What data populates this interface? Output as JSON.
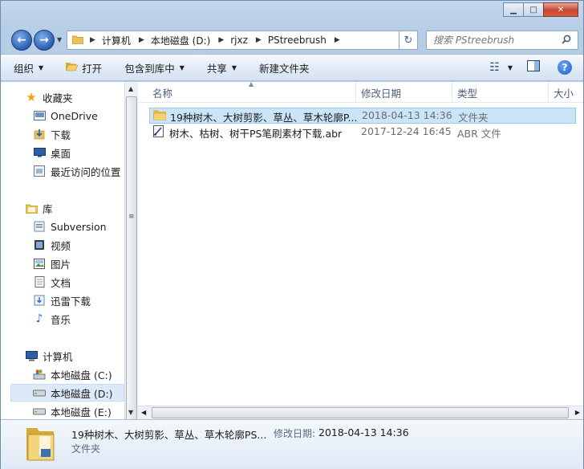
{
  "window": {
    "minimize_icon": "minimize-icon",
    "maximize_icon": "maximize-icon",
    "close_icon": "close-icon"
  },
  "address": {
    "segments": [
      "计算机",
      "本地磁盘 (D:)",
      "rjxz",
      "PStreebrush"
    ],
    "search_placeholder": "搜索 PStreebrush"
  },
  "toolbar": {
    "organize": "组织",
    "open": "打开",
    "include_library": "包含到库中",
    "share": "共享",
    "new_folder": "新建文件夹"
  },
  "nav": {
    "favorites_header": "收藏夹",
    "favorites": [
      "OneDrive",
      "下载",
      "桌面",
      "最近访问的位置"
    ],
    "libraries_header": "库",
    "libraries": [
      "Subversion",
      "视频",
      "图片",
      "文档",
      "迅雷下载",
      "音乐"
    ],
    "computer_header": "计算机",
    "drives": [
      "本地磁盘 (C:)",
      "本地磁盘 (D:)",
      "本地磁盘 (E:)"
    ],
    "selected": "本地磁盘 (D:)"
  },
  "columns": {
    "name": "名称",
    "date": "修改日期",
    "type": "类型",
    "size": "大小"
  },
  "files": [
    {
      "name": "19种树木、大树剪影、草丛、草木轮廓P...",
      "date": "2018-04-13 14:36",
      "type": "文件夹",
      "icon": "folder-icon",
      "selected": true
    },
    {
      "name": "树木、枯树、树干PS笔刷素材下载.abr",
      "date": "2017-12-24 16:45",
      "type": "ABR 文件",
      "icon": "abr-file-icon",
      "selected": false
    }
  ],
  "details": {
    "name": "19种树木、大树剪影、草丛、草木轮廓PS...",
    "date_label": "修改日期:",
    "date": "2018-04-13 14:36",
    "type": "文件夹"
  },
  "colors": {
    "selection": "#cce4f7",
    "nav_selection": "#dce9f8",
    "chrome": "#b6cde6",
    "close_button": "#c7452f"
  }
}
